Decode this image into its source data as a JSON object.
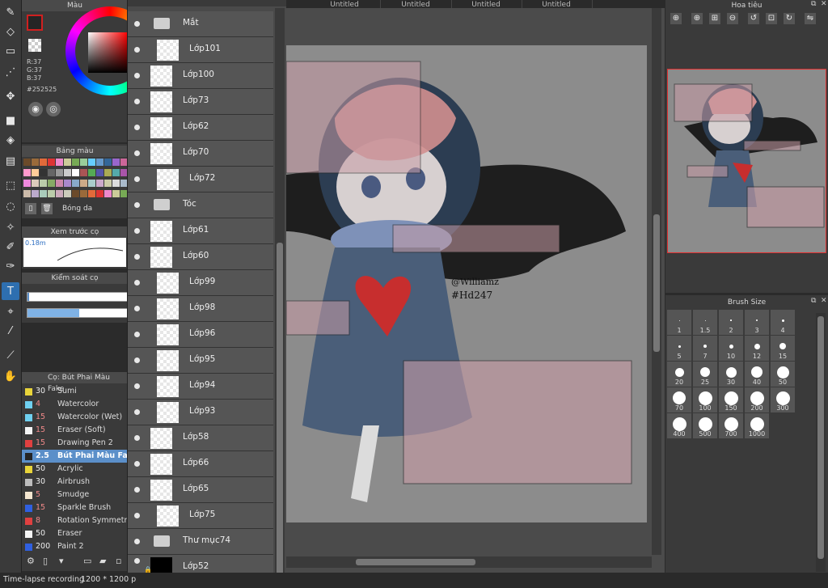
{
  "panels": {
    "color_title": "Màu",
    "palette_title": "Bảng màu",
    "brush_preview_title": "Xem trước cọ",
    "brush_control_title": "Kiểm soát cọ",
    "brush_list_title": "Cọ: Bút Phai Màu Fake",
    "navigator_title": "Hoa tiêu",
    "brush_size_title": "Brush Size"
  },
  "color": {
    "r": "R:37",
    "g": "G:37",
    "b": "B:37",
    "hex": "#252525",
    "fg": "#252525"
  },
  "palette_footer_label": "Bóng da",
  "brush_preview_size": "0.18m",
  "brushes": [
    {
      "size": "30",
      "name": "Sumi",
      "chip": "#e8d43a"
    },
    {
      "size": "4",
      "name": "Watercolor",
      "chip": "#6fd0f0"
    },
    {
      "size": "15",
      "name": "Watercolor (Wet)",
      "chip": "#6fd0f0"
    },
    {
      "size": "15",
      "name": "Eraser (Soft)",
      "chip": "#f4f4f4"
    },
    {
      "size": "15",
      "name": "Drawing Pen 2",
      "chip": "#e04040"
    },
    {
      "size": "2.5",
      "name": "Bút Phai Màu Fake",
      "chip": "#252525"
    },
    {
      "size": "50",
      "name": "Acrylic",
      "chip": "#e8d43a"
    },
    {
      "size": "30",
      "name": "Airbrush",
      "chip": "#bdbdbd"
    },
    {
      "size": "5",
      "name": "Smudge",
      "chip": "#f4e6d0"
    },
    {
      "size": "15",
      "name": "Sparkle Brush",
      "chip": "#3060e0"
    },
    {
      "size": "8",
      "name": "Rotation Symmetry",
      "chip": "#e04040"
    },
    {
      "size": "50",
      "name": "Eraser",
      "chip": "#f4f4f4"
    },
    {
      "size": "200",
      "name": "Paint 2",
      "chip": "#3060e0"
    }
  ],
  "layers": [
    {
      "name": "Mắt",
      "type": "folder"
    },
    {
      "name": "Lớp101",
      "type": "layer",
      "indent": true
    },
    {
      "name": "Lớp100",
      "type": "layer"
    },
    {
      "name": "Lớp73",
      "type": "layer"
    },
    {
      "name": "Lớp62",
      "type": "layer"
    },
    {
      "name": "Lớp70",
      "type": "layer"
    },
    {
      "name": "Lớp72",
      "type": "layer",
      "indent": true
    },
    {
      "name": "Tóc",
      "type": "folder"
    },
    {
      "name": "Lớp61",
      "type": "layer"
    },
    {
      "name": "Lớp60",
      "type": "layer"
    },
    {
      "name": "Lớp99",
      "type": "layer",
      "indent": true
    },
    {
      "name": "Lớp98",
      "type": "layer",
      "indent": true
    },
    {
      "name": "Lớp96",
      "type": "layer",
      "indent": true
    },
    {
      "name": "Lớp95",
      "type": "layer",
      "indent": true
    },
    {
      "name": "Lớp94",
      "type": "layer",
      "indent": true
    },
    {
      "name": "Lớp93",
      "type": "layer",
      "indent": true
    },
    {
      "name": "Lớp58",
      "type": "layer"
    },
    {
      "name": "Lớp66",
      "type": "layer"
    },
    {
      "name": "Lớp65",
      "type": "layer"
    },
    {
      "name": "Lớp75",
      "type": "layer",
      "indent": true
    },
    {
      "name": "Thư mục74",
      "type": "folder"
    },
    {
      "name": "Lớp52",
      "type": "layer",
      "locked": true
    }
  ],
  "tabs": [
    "Untitled",
    "Untitled",
    "Untitled",
    "Untitled"
  ],
  "canvas_text": {
    "line1": "@Williamz",
    "line2": "#Hd247"
  },
  "brush_sizes": [
    "1",
    "1.5",
    "2",
    "3",
    "4",
    "5",
    "7",
    "10",
    "12",
    "15",
    "20",
    "25",
    "30",
    "40",
    "50",
    "70",
    "100",
    "150",
    "200",
    "300",
    "400",
    "500",
    "700",
    "1000"
  ],
  "status": {
    "recording": "Time-lapse recording",
    "size": "1200 * 1200 p"
  }
}
